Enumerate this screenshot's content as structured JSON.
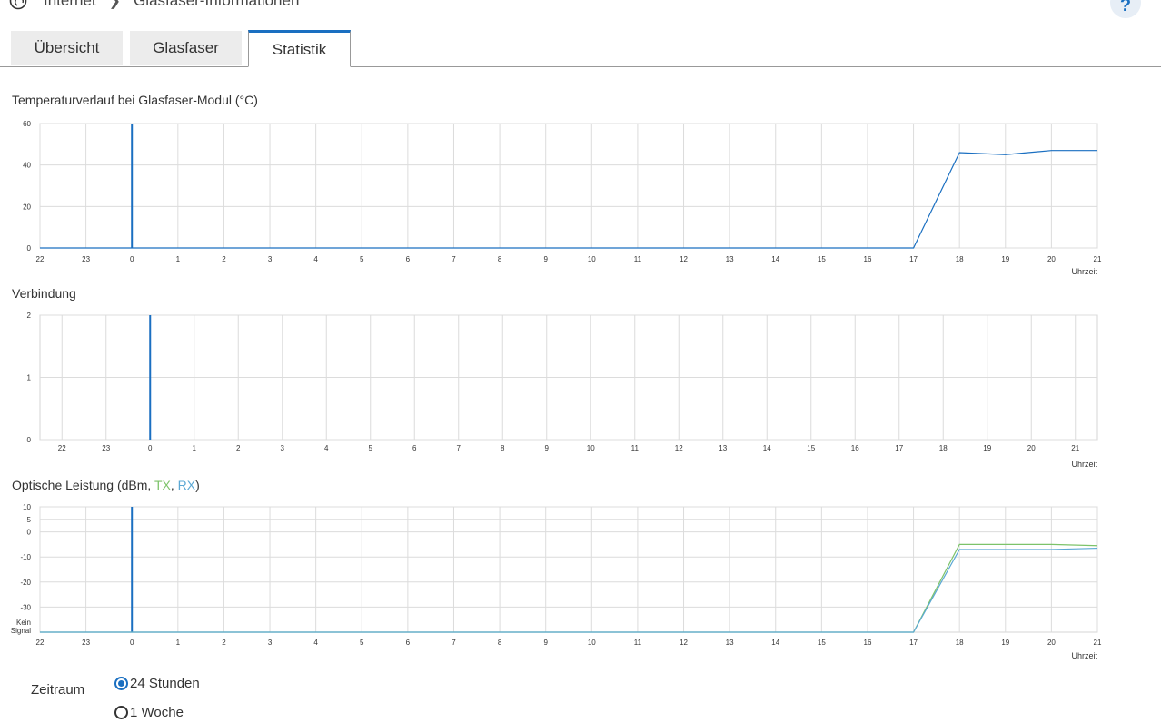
{
  "breadcrumb": {
    "section": "Internet",
    "page": "Glasfaser-Informationen"
  },
  "help_label": "?",
  "tabs": [
    {
      "label": "Übersicht"
    },
    {
      "label": "Glasfaser"
    },
    {
      "label": "Statistik",
      "active": true
    }
  ],
  "colors": {
    "accent": "#1a6fc1",
    "tx": "#7dc36a",
    "rx": "#5ba8d4",
    "grid": "#dddddd"
  },
  "chart_data": [
    {
      "type": "line",
      "title": "Temperaturverlauf bei Glasfaser-Modul (°C)",
      "xlabel": "Uhrzeit",
      "x": [
        "22",
        "23",
        "0",
        "1",
        "2",
        "3",
        "4",
        "5",
        "6",
        "7",
        "8",
        "9",
        "10",
        "11",
        "12",
        "13",
        "14",
        "15",
        "16",
        "17",
        "18",
        "19",
        "20",
        "21"
      ],
      "ylim": [
        0,
        60
      ],
      "yticks": [
        0,
        20,
        40,
        60
      ],
      "marker_at": "0",
      "series": [
        {
          "values": [
            0,
            0,
            0,
            0,
            0,
            0,
            0,
            0,
            0,
            0,
            0,
            0,
            0,
            0,
            0,
            0,
            0,
            0,
            0,
            0,
            46,
            45,
            47,
            47
          ]
        }
      ]
    },
    {
      "type": "line",
      "title": "Verbindung",
      "xlabel": "Uhrzeit",
      "x": [
        "22",
        "23",
        "0",
        "1",
        "2",
        "3",
        "4",
        "5",
        "6",
        "7",
        "8",
        "9",
        "10",
        "11",
        "12",
        "13",
        "14",
        "15",
        "16",
        "17",
        "18",
        "19",
        "20",
        "21"
      ],
      "ylim": [
        0,
        2
      ],
      "yticks": [
        0,
        1,
        2
      ],
      "marker_at": "0",
      "series": []
    },
    {
      "type": "line",
      "title_prefix": "Optische Leistung (dBm, ",
      "title_tx": "TX",
      "title_sep": ", ",
      "title_rx": "RX",
      "title_suffix": ")",
      "xlabel": "Uhrzeit",
      "x": [
        "22",
        "23",
        "0",
        "1",
        "2",
        "3",
        "4",
        "5",
        "6",
        "7",
        "8",
        "9",
        "10",
        "11",
        "12",
        "13",
        "14",
        "15",
        "16",
        "17",
        "18",
        "19",
        "20",
        "21"
      ],
      "ylim": [
        -40,
        10
      ],
      "yticks": [
        -30,
        -20,
        -10,
        0,
        5,
        10
      ],
      "ybottom_label": [
        "Kein",
        "Signal"
      ],
      "marker_at": "0",
      "series": [
        {
          "name": "TX",
          "values": [
            -40,
            -40,
            -40,
            -40,
            -40,
            -40,
            -40,
            -40,
            -40,
            -40,
            -40,
            -40,
            -40,
            -40,
            -40,
            -40,
            -40,
            -40,
            -40,
            -40,
            -5,
            -5,
            -5,
            -5.5
          ]
        },
        {
          "name": "RX",
          "values": [
            -40,
            -40,
            -40,
            -40,
            -40,
            -40,
            -40,
            -40,
            -40,
            -40,
            -40,
            -40,
            -40,
            -40,
            -40,
            -40,
            -40,
            -40,
            -40,
            -40,
            -7,
            -7,
            -7,
            -6.5
          ]
        }
      ]
    }
  ],
  "zeitraum": {
    "label": "Zeitraum",
    "options": [
      {
        "label": "24 Stunden",
        "selected": true
      },
      {
        "label": "1 Woche",
        "selected": false
      }
    ]
  }
}
